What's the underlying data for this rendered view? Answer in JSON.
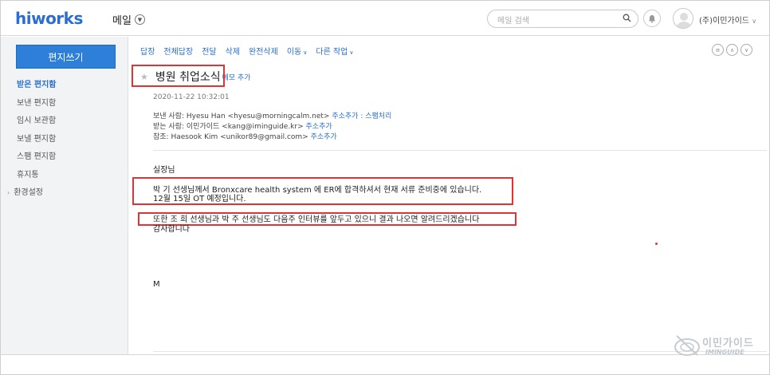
{
  "header": {
    "logo": "hiworks",
    "app_menu": "메일",
    "search_placeholder": "메일 검색",
    "user_name": "(주)이민가이드"
  },
  "sidebar": {
    "compose_label": "편지쓰기",
    "folders": [
      {
        "label": "받은 편지함",
        "active": true
      },
      {
        "label": "보낸 편지함"
      },
      {
        "label": "임시 보관함"
      },
      {
        "label": "보낼 편지함"
      },
      {
        "label": "스팸 편지함"
      },
      {
        "label": "휴지통"
      },
      {
        "label": "환경설정"
      }
    ]
  },
  "toolbar": {
    "reply": "답장",
    "reply_all": "전체답장",
    "forward": "전달",
    "delete": "삭제",
    "delete_perm": "완전삭제",
    "move": "이동",
    "more": "다른 작업"
  },
  "mail": {
    "subject": "병원 취업소식",
    "memo_add": "메모 추가",
    "date": "2020-11-22 10:32:01",
    "from_label": "보낸 사람:",
    "from_value": "Hyesu Han <hyesu@morningcalm.net>",
    "from_links": "주소추가 : 스팸처리",
    "to_label": "받는 사람:",
    "to_value": "이민가이드 <kang@iminguide.kr>",
    "to_links": "주소추가",
    "cc_label": "참조:",
    "cc_value": "Haesook Kim <unikor89@gmail.com>",
    "cc_links": "주소추가",
    "body": {
      "greeting": "실장님",
      "line1": "박   기 선생님께서 Bronxcare health system 에 ER에 합격하셔서 현재 서류 준비중에 있습니다.",
      "line2": "12월 15일 OT 예정입니다.",
      "line3": "또한 조   희 선생님과 박   주 선생님도 다음주 인터뷰를 앞두고 있으니 결과 나오면 알려드리겠습니다",
      "line4": "감사합니다",
      "sign": "M"
    }
  },
  "watermark": {
    "text_ko": "이민가이드",
    "text_en": "IMINGUIDE"
  },
  "colors": {
    "accent": "#2a6fcf",
    "compose_bg": "#2e7fd8",
    "highlight_box": "#e03434",
    "sidebar_bg": "#f1f3f5"
  }
}
